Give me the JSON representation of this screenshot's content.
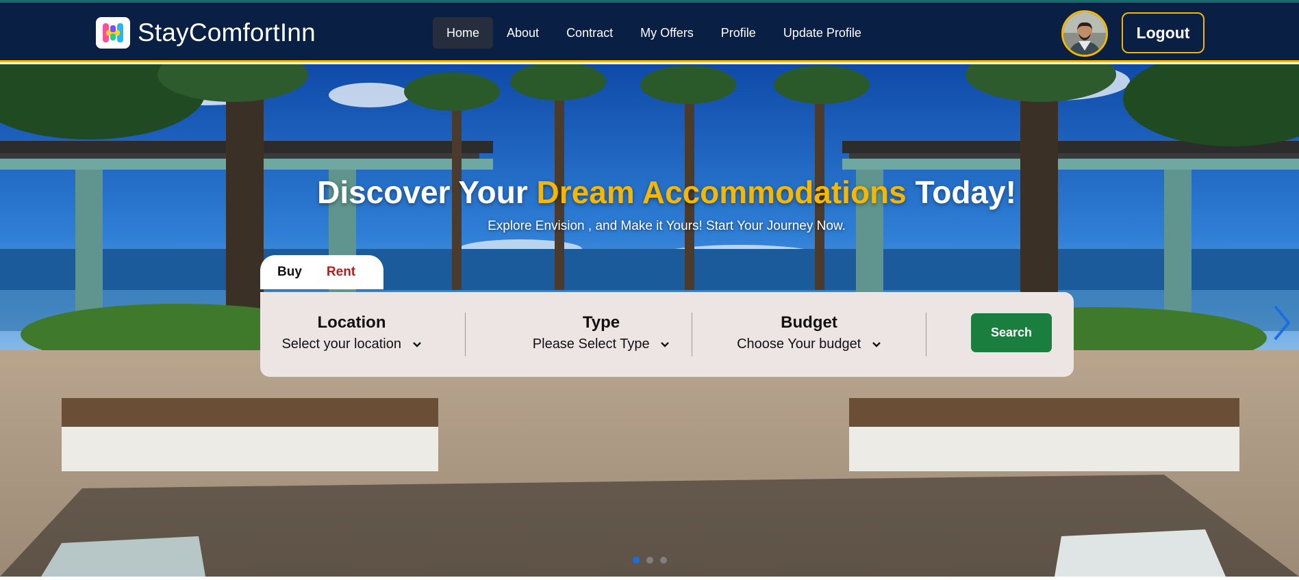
{
  "brand": {
    "name": "StayComfortInn",
    "logo_icon": "hotel-h-icon"
  },
  "nav": {
    "items": [
      {
        "label": "Home",
        "active": true
      },
      {
        "label": "About",
        "active": false
      },
      {
        "label": "Contract",
        "active": false
      },
      {
        "label": "My Offers",
        "active": false
      },
      {
        "label": "Profile",
        "active": false
      },
      {
        "label": "Update Profile",
        "active": false
      }
    ],
    "logout_label": "Logout",
    "avatar_icon": "user-avatar"
  },
  "hero": {
    "title_part1": "Discover Your",
    "title_accent": "Dream Accommodations",
    "title_part2": "Today!",
    "subtitle": "Explore Envision , and Make it Yours! Start Your Journey Now."
  },
  "search": {
    "tabs": [
      {
        "label": "Buy",
        "active": true
      },
      {
        "label": "Rent",
        "active": false
      }
    ],
    "fields": [
      {
        "label": "Location",
        "value": "Select your location"
      },
      {
        "label": "Type",
        "value": "Please Select Type"
      },
      {
        "label": "Budget",
        "value": "Choose Your budget"
      }
    ],
    "button_label": "Search"
  },
  "carousel": {
    "slide_count": 3,
    "active_index": 0
  },
  "colors": {
    "nav_bg": "#0a1f44",
    "accent": "#f5b700",
    "search_button": "#1a7f3e",
    "rent_tab": "#b21d1d",
    "active_dot": "#1a6fe0"
  }
}
